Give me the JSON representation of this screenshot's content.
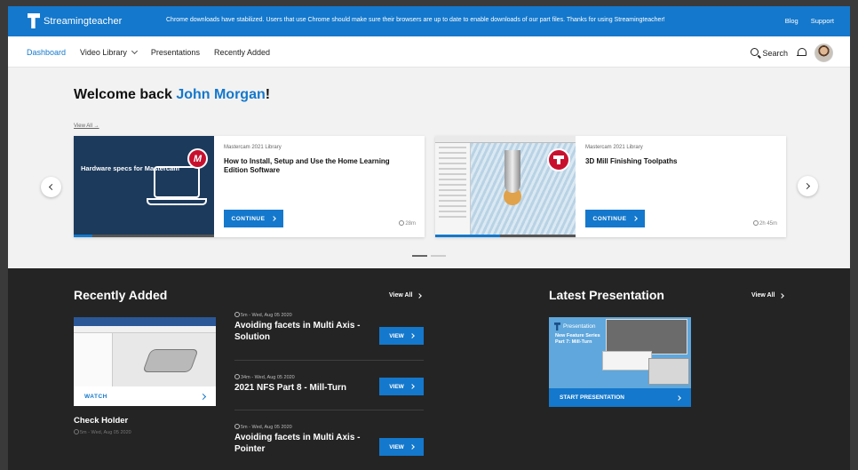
{
  "topbar": {
    "brand": "Streamingteacher",
    "announcement": "Chrome downloads have stabilized. Users that use Chrome should make sure their browsers are up to date to enable downloads of our part files. Thanks for using Streamingteacher!",
    "links": [
      "Blog",
      "Support"
    ]
  },
  "nav": {
    "items": [
      {
        "label": "Dashboard",
        "active": true
      },
      {
        "label": "Video Library",
        "dropdown": true
      },
      {
        "label": "Presentations"
      },
      {
        "label": "Recently Added"
      }
    ],
    "search_label": "Search"
  },
  "hero": {
    "welcome_prefix": "Welcome back ",
    "user_name": "John Morgan",
    "welcome_suffix": "!",
    "view_all": "View All →",
    "cards": [
      {
        "library": "Mastercam 2021 Library",
        "title": "How to Install, Setup and Use the Home Learning Edition Software",
        "button": "CONTINUE",
        "duration": "28m",
        "progress": 0.13,
        "thumb_text": "Hardware specs for Mastercam",
        "logo_letter": "M"
      },
      {
        "library": "Mastercam 2021 Library",
        "title": "3D Mill Finishing Toolpaths",
        "button": "CONTINUE",
        "duration": "2h 45m",
        "progress": 0.46
      }
    ],
    "carousel_pages": 2,
    "carousel_current": 0
  },
  "recent": {
    "title": "Recently Added",
    "view_all": "View All",
    "featured": {
      "watch_label": "WATCH",
      "name": "Check Holder",
      "meta": "5m - Wed, Aug 05 2020"
    },
    "items": [
      {
        "meta": "5m - Wed, Aug 05 2020",
        "title": "Avoiding facets in Multi Axis - Solution",
        "button": "VIEW"
      },
      {
        "meta": "34m - Wed, Aug 05 2020",
        "title": "2021 NFS Part 8 - Mill-Turn",
        "button": "VIEW"
      },
      {
        "meta": "5m - Wed, Aug 05 2020",
        "title": "Avoiding facets in Multi Axis - Pointer",
        "button": "VIEW"
      }
    ]
  },
  "presentation": {
    "title": "Latest Presentation",
    "view_all": "View All",
    "thumb_header": "Presentation",
    "thumb_title": "New Feature Series Part 7: Mill-Turn",
    "button": "START PRESENTATION"
  },
  "colors": {
    "accent": "#1478cc",
    "dark_bg": "#242424",
    "hero_bg": "#f2f2f2"
  }
}
